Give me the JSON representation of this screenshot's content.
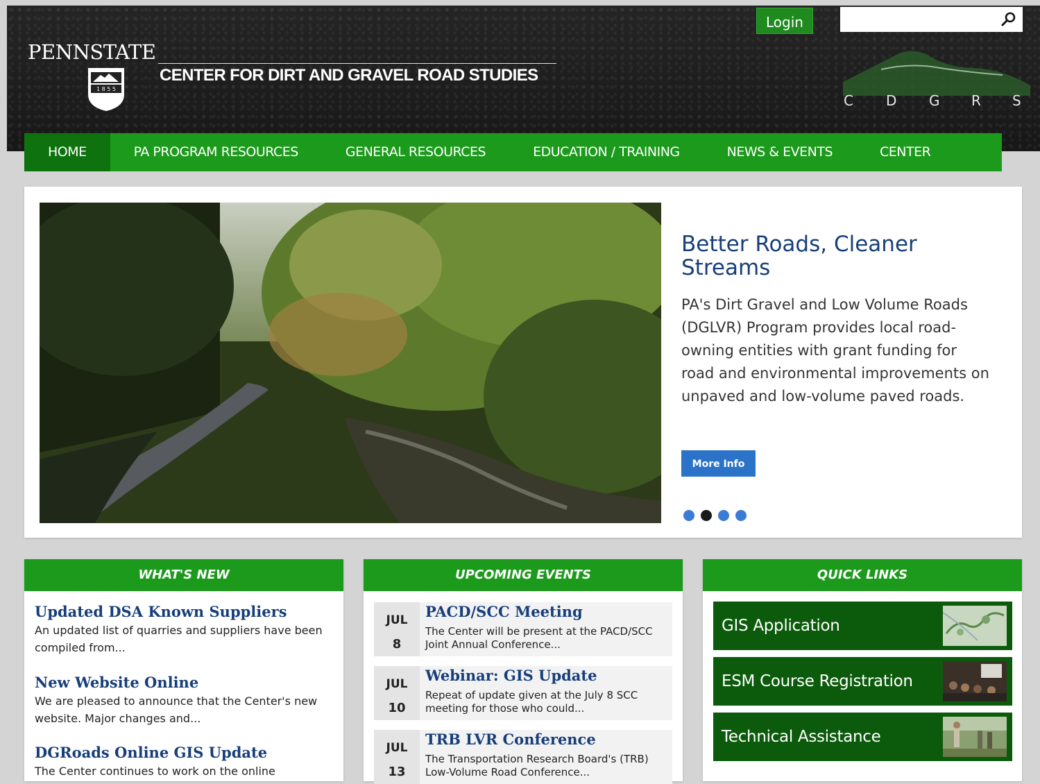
{
  "header": {
    "pennstate_word": "PENNSTATE",
    "shield_year": "1 8 5 5",
    "center_title": "CENTER FOR DIRT AND GRAVEL ROAD STUDIES",
    "login_label": "Login",
    "search": {
      "placeholder": "",
      "value": ""
    },
    "cdgrs_letters": [
      "C",
      "D",
      "G",
      "R",
      "S"
    ]
  },
  "nav": {
    "items": [
      {
        "label": "HOME",
        "active": true
      },
      {
        "label": "PA PROGRAM RESOURCES",
        "active": false
      },
      {
        "label": "GENERAL RESOURCES",
        "active": false
      },
      {
        "label": "EDUCATION / TRAINING",
        "active": false
      },
      {
        "label": "NEWS & EVENTS",
        "active": false
      },
      {
        "label": "CENTER",
        "active": false
      }
    ]
  },
  "hero": {
    "title": "Better Roads, Cleaner Streams",
    "text": "PA's Dirt Gravel and Low Volume Roads (DGLVR) Program provides local road-owning entities with grant funding for road and environmental improvements on unpaved and low-volume paved roads.",
    "button_label": "More Info",
    "slide_count": 4,
    "active_slide": 2
  },
  "whats_new": {
    "heading": "WHAT'S NEW",
    "items": [
      {
        "title": "Updated DSA Known Suppliers",
        "text": "An updated list of quarries and suppliers have been compiled from..."
      },
      {
        "title": "New Website Online",
        "text": "We are pleased to announce that the Center's new website. Major changes and..."
      },
      {
        "title": "DGRoads Online GIS Update",
        "text": "The Center continues to work on the online"
      }
    ]
  },
  "upcoming_events": {
    "heading": "UPCOMING EVENTS",
    "items": [
      {
        "month": "JUL",
        "day": "8",
        "title": "PACD/SCC Meeting",
        "text": "The Center will be present at the PACD/SCC Joint Annual Conference..."
      },
      {
        "month": "JUL",
        "day": "10",
        "title": "Webinar: GIS Update",
        "text": "Repeat of update given at the July 8 SCC meeting for those who could..."
      },
      {
        "month": "JUL",
        "day": "13",
        "title": "TRB LVR Conference",
        "text": "The Transportation Research Board's (TRB) Low-Volume Road Conference..."
      }
    ]
  },
  "quick_links": {
    "heading": "QUICK LINKS",
    "items": [
      {
        "label": "GIS Application",
        "thumb": "map-thumbnail"
      },
      {
        "label": "ESM Course Registration",
        "thumb": "classroom-thumbnail"
      },
      {
        "label": "Technical Assistance",
        "thumb": "field-thumbnail"
      }
    ]
  },
  "colors": {
    "nav_green": "#1c9a1c",
    "nav_active": "#0e720e",
    "quick_link_green": "#0c5b0c",
    "heading_blue": "#173e7a",
    "button_blue": "#2b73c8"
  }
}
